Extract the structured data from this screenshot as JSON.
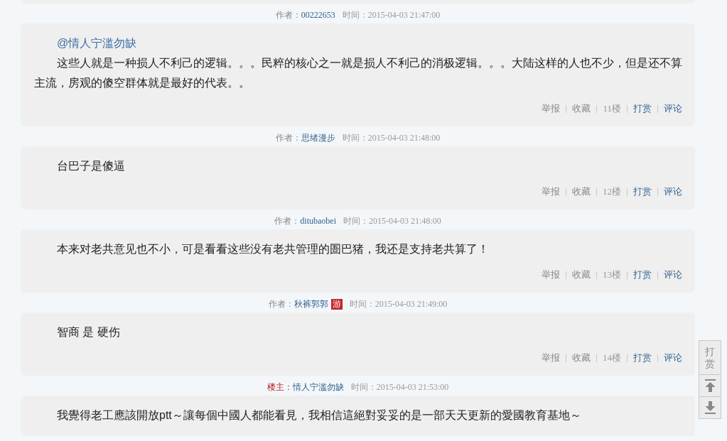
{
  "posts": [
    {
      "author_label": "作者：",
      "is_op": false,
      "author": "00222653",
      "time_label": "时间：",
      "time": "2015-04-03 21:47:00",
      "mention": "@情人宁滥勿缺",
      "body": "这些人就是一种损人不利己的逻辑。。。民粹的核心之一就是损人不利己的消极逻辑。。。大陆这样的人也不少，但是还不算主流，房观的傻空群体就是最好的代表。。",
      "actions": [
        {
          "label": "举报",
          "kind": "link"
        },
        {
          "label": "收藏",
          "kind": "link"
        },
        {
          "label": "11楼",
          "kind": "floor"
        },
        {
          "label": "打赏",
          "kind": "accent"
        },
        {
          "label": "评论",
          "kind": "accent"
        }
      ]
    },
    {
      "author_label": "作者：",
      "is_op": false,
      "author": "思绪漫步",
      "time_label": "时间：",
      "time": "2015-04-03 21:48:00",
      "body": "台巴子是傻逼",
      "actions": [
        {
          "label": "举报",
          "kind": "link"
        },
        {
          "label": "收藏",
          "kind": "link"
        },
        {
          "label": "12楼",
          "kind": "floor"
        },
        {
          "label": "打赏",
          "kind": "accent"
        },
        {
          "label": "评论",
          "kind": "accent"
        }
      ]
    },
    {
      "author_label": "作者：",
      "is_op": false,
      "author": "ditubaobei",
      "time_label": "时间：",
      "time": "2015-04-03 21:48:00",
      "body": "本来对老共意见也不小，可是看看这些没有老共管理的圄巴猪，我还是支持老共算了！",
      "actions": [
        {
          "label": "举报",
          "kind": "link"
        },
        {
          "label": "收藏",
          "kind": "link"
        },
        {
          "label": "13楼",
          "kind": "floor"
        },
        {
          "label": "打赏",
          "kind": "accent"
        },
        {
          "label": "评论",
          "kind": "accent"
        }
      ]
    },
    {
      "author_label": "作者：",
      "is_op": false,
      "author": "秋裤郭郭",
      "badge": "游",
      "time_label": "时间：",
      "time": "2015-04-03 21:49:00",
      "body": "智商 是 硬伤",
      "actions": [
        {
          "label": "举报",
          "kind": "link"
        },
        {
          "label": "收藏",
          "kind": "link"
        },
        {
          "label": "14楼",
          "kind": "floor"
        },
        {
          "label": "打赏",
          "kind": "accent"
        },
        {
          "label": "评论",
          "kind": "accent"
        }
      ]
    },
    {
      "author_label": "楼主：",
      "is_op": true,
      "author": "情人宁滥勿缺",
      "time_label": "时间：",
      "time": "2015-04-03 21:53:00",
      "body": "我覺得老工應該開放ptt～讓每個中國人都能看見，我相信這絕對妥妥的是一部天天更新的愛國教育基地～"
    }
  ],
  "side_tools": [
    {
      "kind": "text",
      "label": "打赏"
    },
    {
      "kind": "top"
    },
    {
      "kind": "bottom"
    }
  ]
}
